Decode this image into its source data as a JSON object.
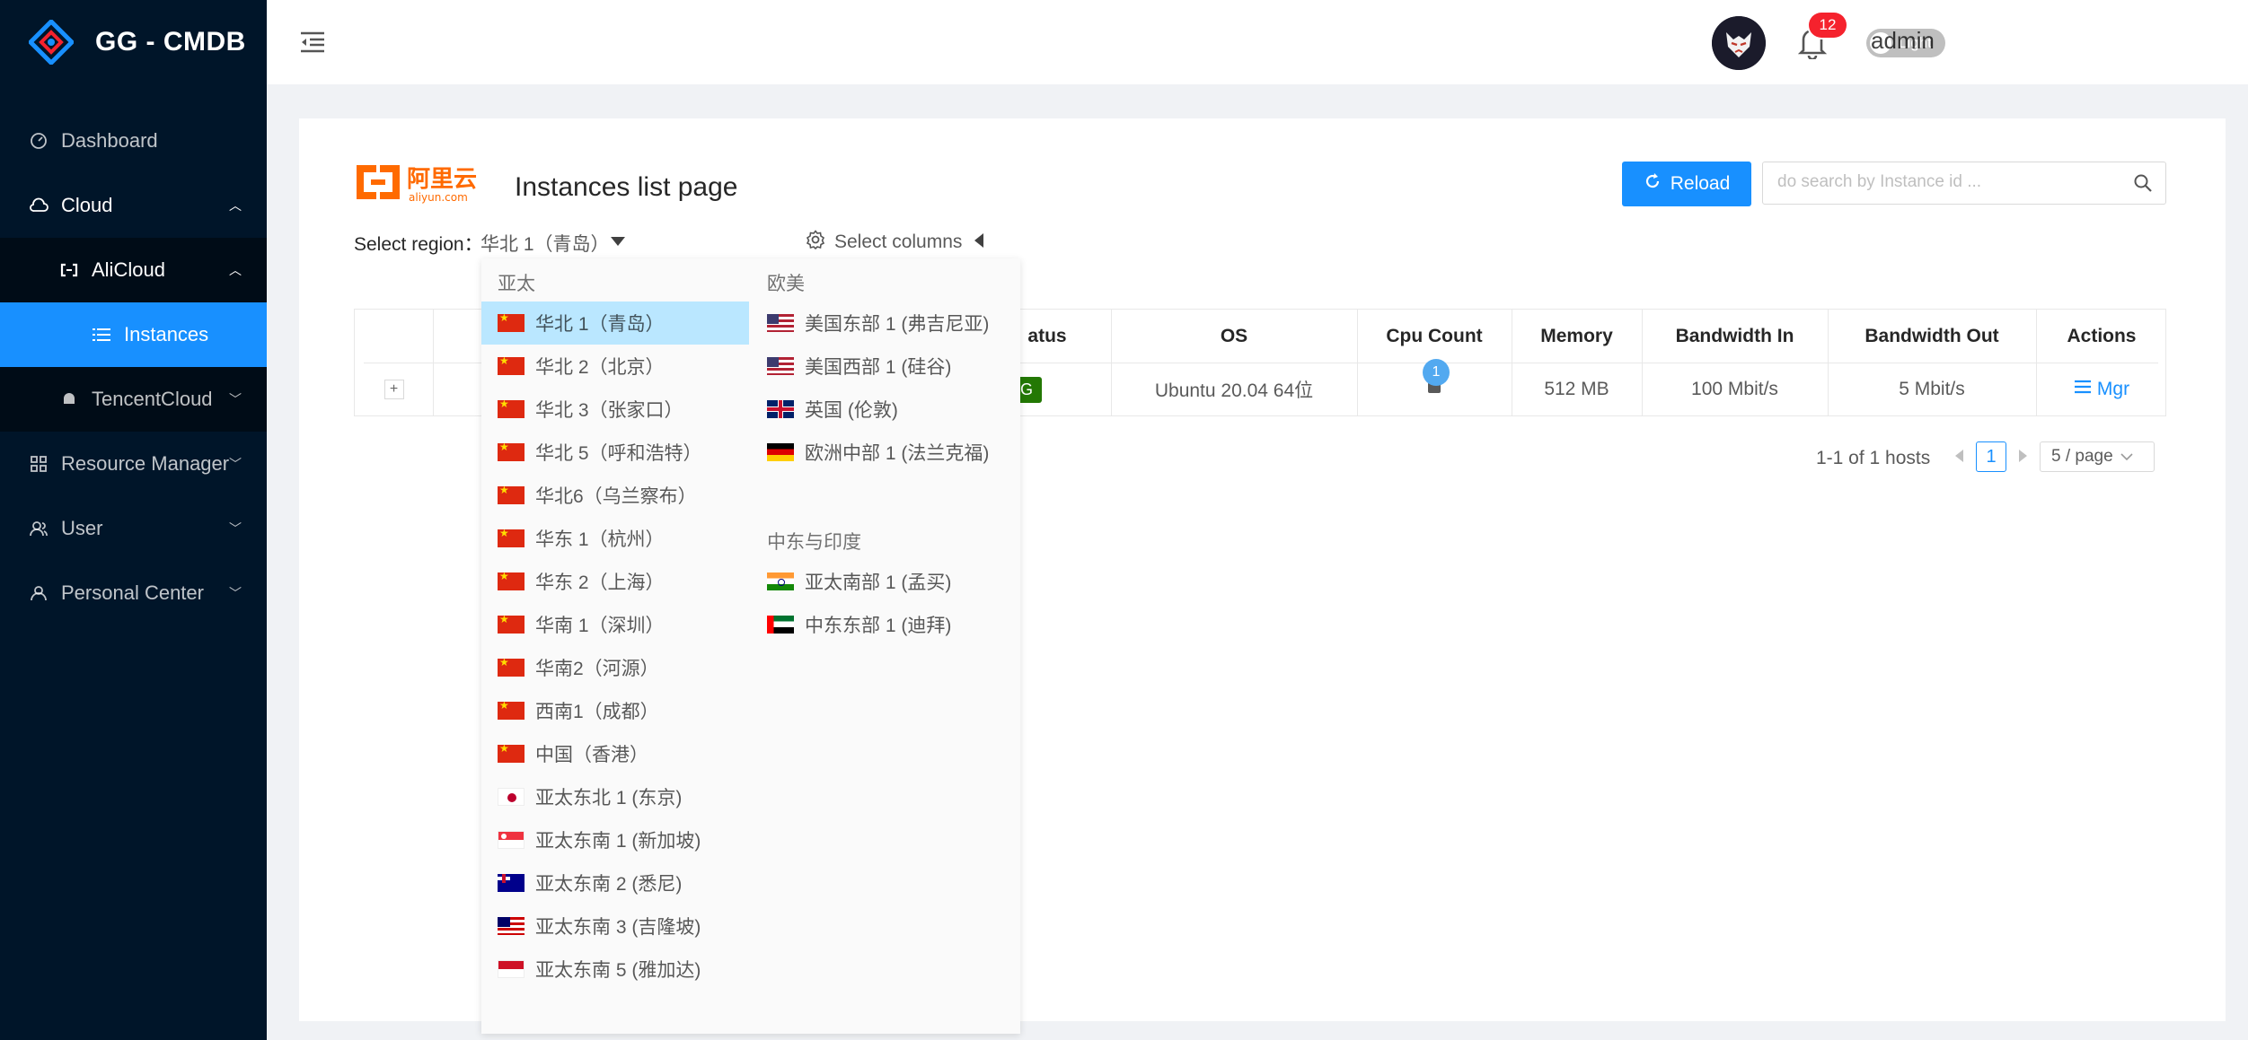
{
  "brand": {
    "title": "GG - CMDB"
  },
  "sidebar": {
    "dashboard": "Dashboard",
    "cloud": "Cloud",
    "alicloud": "AliCloud",
    "instances": "Instances",
    "tencentcloud": "TencentCloud",
    "resource_manager": "Resource Manager",
    "user": "User",
    "personal_center": "Personal Center"
  },
  "header": {
    "theme_label": "Light",
    "notification_count": "12",
    "username": "admin"
  },
  "page": {
    "logo_text": "阿里云",
    "logo_sub": "aliyun.com",
    "title": "Instances list page",
    "reload_label": "Reload",
    "search_placeholder": "do search by Instance id ...",
    "region_label": "Select region：",
    "region_value": "华北 1（青岛）",
    "select_columns": "Select columns"
  },
  "table": {
    "headers": {
      "status": "atus",
      "os": "OS",
      "cpu": "Cpu Count",
      "memory": "Memory",
      "bw_in": "Bandwidth In",
      "bw_out": "Bandwidth Out",
      "actions": "Actions"
    },
    "row": {
      "expand": "+",
      "status": "NING",
      "os": "Ubuntu 20.04 64位",
      "cpu": "1",
      "memory": "512 MB",
      "bw_in": "100 Mbit/s",
      "bw_out": "5 Mbit/s",
      "action": "Mgr"
    }
  },
  "pagination": {
    "info": "1-1 of 1 hosts",
    "current": "1",
    "page_size": "5 / page"
  },
  "dropdown": {
    "groups": {
      "asia": "亚太",
      "euro_america": "欧美",
      "middle_east_india": "中东与印度"
    },
    "asia": [
      {
        "label": "华北 1（青岛）",
        "flag": "cn"
      },
      {
        "label": "华北 2（北京）",
        "flag": "cn"
      },
      {
        "label": "华北 3（张家口）",
        "flag": "cn"
      },
      {
        "label": "华北 5（呼和浩特）",
        "flag": "cn"
      },
      {
        "label": "华北6（乌兰察布）",
        "flag": "cn"
      },
      {
        "label": "华东 1（杭州）",
        "flag": "cn"
      },
      {
        "label": "华东 2（上海）",
        "flag": "cn"
      },
      {
        "label": "华南 1（深圳）",
        "flag": "cn"
      },
      {
        "label": "华南2（河源）",
        "flag": "cn"
      },
      {
        "label": "西南1（成都）",
        "flag": "cn"
      },
      {
        "label": "中国（香港）",
        "flag": "cn"
      },
      {
        "label": "亚太东北 1 (东京)",
        "flag": "jp"
      },
      {
        "label": "亚太东南 1 (新加坡)",
        "flag": "sg"
      },
      {
        "label": "亚太东南 2 (悉尼)",
        "flag": "au"
      },
      {
        "label": "亚太东南 3 (吉隆坡)",
        "flag": "my"
      },
      {
        "label": "亚太东南 5 (雅加达)",
        "flag": "id"
      }
    ],
    "euro_america": [
      {
        "label": "美国东部 1 (弗吉尼亚)",
        "flag": "us"
      },
      {
        "label": "美国西部 1 (硅谷)",
        "flag": "us"
      },
      {
        "label": "英国 (伦敦)",
        "flag": "uk"
      },
      {
        "label": "欧洲中部 1 (法兰克福)",
        "flag": "de"
      }
    ],
    "middle_east_india": [
      {
        "label": "亚太南部 1 (孟买)",
        "flag": "in"
      },
      {
        "label": "中东东部 1 (迪拜)",
        "flag": "ae"
      }
    ]
  },
  "colors": {
    "primary": "#1890ff",
    "sidebar_bg": "#001529",
    "selected_option": "#bae7ff",
    "status_running": "#237804",
    "badge_red": "#f5222d"
  }
}
